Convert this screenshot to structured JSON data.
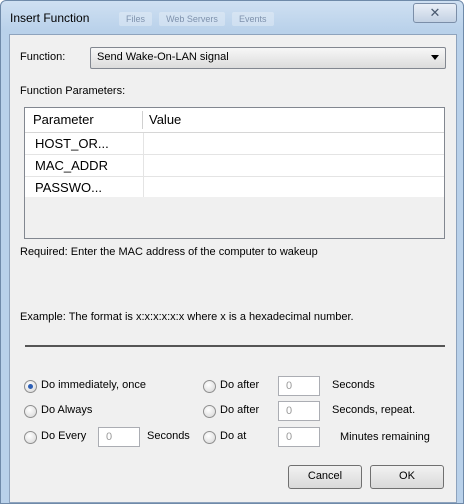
{
  "window": {
    "title": "Insert Function",
    "close_glyph": "✕",
    "ghost_tabs": [
      "Files",
      "Web Servers",
      "Events"
    ]
  },
  "function": {
    "label": "Function:",
    "selected": "Send Wake-On-LAN signal"
  },
  "params": {
    "label": "Function Parameters:",
    "columns": [
      "Parameter",
      "Value"
    ],
    "rows": [
      {
        "name": "HOST_OR...",
        "value": ""
      },
      {
        "name": "MAC_ADDR",
        "value": ""
      },
      {
        "name": "PASSWO...",
        "value": ""
      }
    ]
  },
  "hints": {
    "required": "Required: Enter the MAC address of the computer to wakeup",
    "example": "Example: The format is x:x:x:x:x:x where x is a hexadecimal number."
  },
  "schedule": {
    "immediately": "Do immediately, once",
    "always": "Do Always",
    "every": "Do Every",
    "every_value": "0",
    "every_unit": "Seconds",
    "after1": "Do after",
    "after1_value": "0",
    "after1_unit": "Seconds",
    "after2": "Do after",
    "after2_value": "0",
    "after2_unit": "Seconds, repeat.",
    "at": "Do at",
    "at_value": "0",
    "at_unit": "Minutes remaining",
    "selected": "immediately"
  },
  "buttons": {
    "cancel": "Cancel",
    "ok": "OK"
  },
  "colors": {
    "title_gradient": "#b9d1ea",
    "client_bg": "#f0f0f0",
    "radio_dot": "#2d5fb5"
  }
}
